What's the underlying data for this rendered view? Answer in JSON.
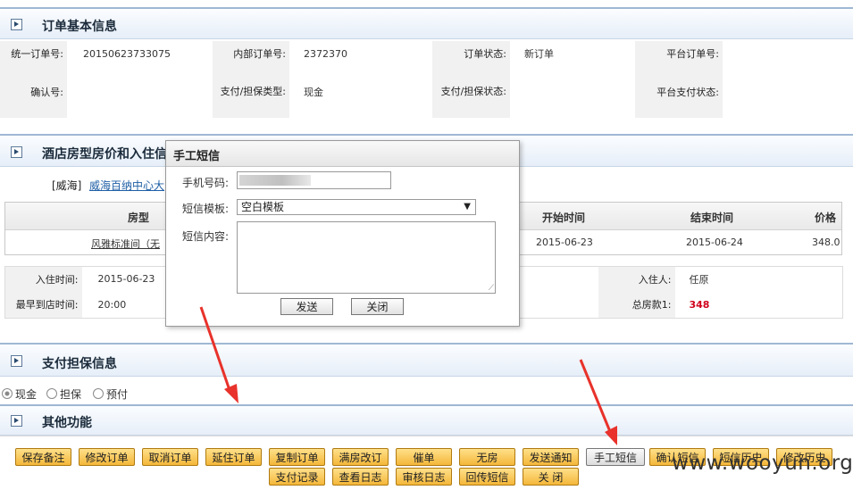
{
  "sections": {
    "order_basic": "订单基本信息",
    "hotel_room": "酒店房型房价和入住信",
    "payment": "支付担保信息",
    "other": "其他功能"
  },
  "order": {
    "unified_no_label": "统一订单号:",
    "unified_no": "20150623733075",
    "internal_no_label": "内部订单号:",
    "internal_no": "2372370",
    "status_label": "订单状态:",
    "status": "新订单",
    "platform_no_label": "平台订单号:",
    "platform_no": "",
    "confirm_no_label": "确认号:",
    "confirm_no": "",
    "pay_type_label": "支付/担保类型:",
    "pay_type": "现金",
    "pay_status_label": "支付/担保状态:",
    "pay_status": "",
    "platform_pay_status_label": "平台支付状态:",
    "platform_pay_status": ""
  },
  "hotel": {
    "city": "[威海]",
    "name_link": "威海百纳中心大"
  },
  "room_table": {
    "headers": {
      "room_type": "房型",
      "start": "开始时间",
      "end": "结束时间",
      "price": "价格"
    },
    "row": {
      "room_type": "风雅标准间（无",
      "start": "2015-06-23",
      "end": "2015-06-24",
      "price": "348.0"
    }
  },
  "stay": {
    "checkin_label": "入住时间:",
    "checkin": "2015-06-23",
    "arrive_label": "最早到店时间:",
    "arrive": "20:00",
    "guest_label": "入住人:",
    "guest": "任原",
    "total_label": "总房款1:",
    "total": "348"
  },
  "payment_options": [
    "现金",
    "担保",
    "预付"
  ],
  "buttons_row1": [
    "保存备注",
    "修改订单",
    "取消订单",
    "延住订单",
    "复制订单",
    "满房改订",
    "催单",
    "无房",
    "发送通知",
    "手工短信",
    "确认短信",
    "短信历史",
    "修改历史"
  ],
  "buttons_row2": [
    "支付记录",
    "查看日志",
    "审核日志",
    "回传短信",
    "关 闭"
  ],
  "dialog": {
    "title": "手工短信",
    "phone_label": "手机号码:",
    "template_label": "短信模板:",
    "template_value": "空白模板",
    "content_label": "短信内容:",
    "send": "发送",
    "close": "关闭"
  },
  "watermark": "www.wooyun.org",
  "colors": {
    "accent_blue": "#9fb8d3",
    "button_orange": "#f4b73a",
    "total_red": "#d0021b",
    "arrow_red": "#e8322b"
  }
}
